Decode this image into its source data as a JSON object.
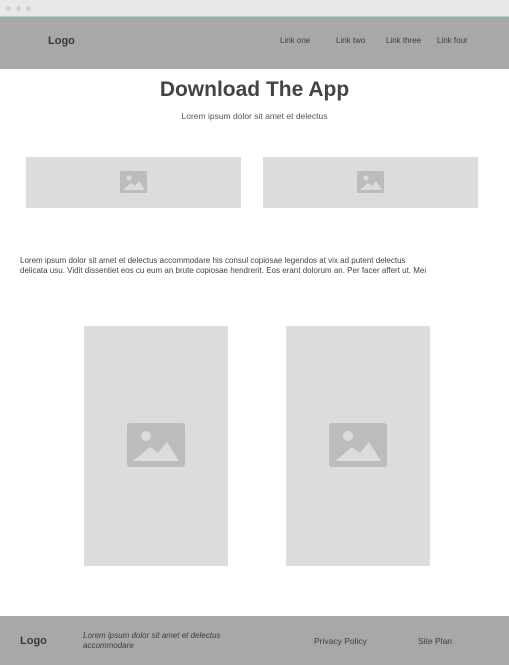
{
  "header": {
    "logo": "Logo",
    "nav": [
      "Link one",
      "Link two",
      "Link three",
      "Link four"
    ]
  },
  "hero": {
    "title": "Download The App",
    "subtitle": "Lorem ipsum dolor sit amet et delectus"
  },
  "body": {
    "paragraph_line1": "Lorem ipsum dolor sit amet et delectus accommodare his consul copiosae legendos at vix ad putent delectus",
    "paragraph_line2": "delicata usu. Vidit dissentiet eos cu eum an brute copiosae hendrerit. Eos erant dolorum an. Per facer affert ut. Mei"
  },
  "images": {
    "icon": "image-placeholder-icon"
  },
  "footer": {
    "logo": "Logo",
    "tagline": "Lorem ipsum dolor sit amet et delectus accommodare",
    "links": [
      "Privacy Policy",
      "Site Plan"
    ]
  },
  "colors": {
    "header_bg": "#a8a8a8",
    "placeholder_bg": "#dcdcdc",
    "placeholder_icon": "#bcbcbc",
    "chrome_accent": "#9fd9dc"
  }
}
